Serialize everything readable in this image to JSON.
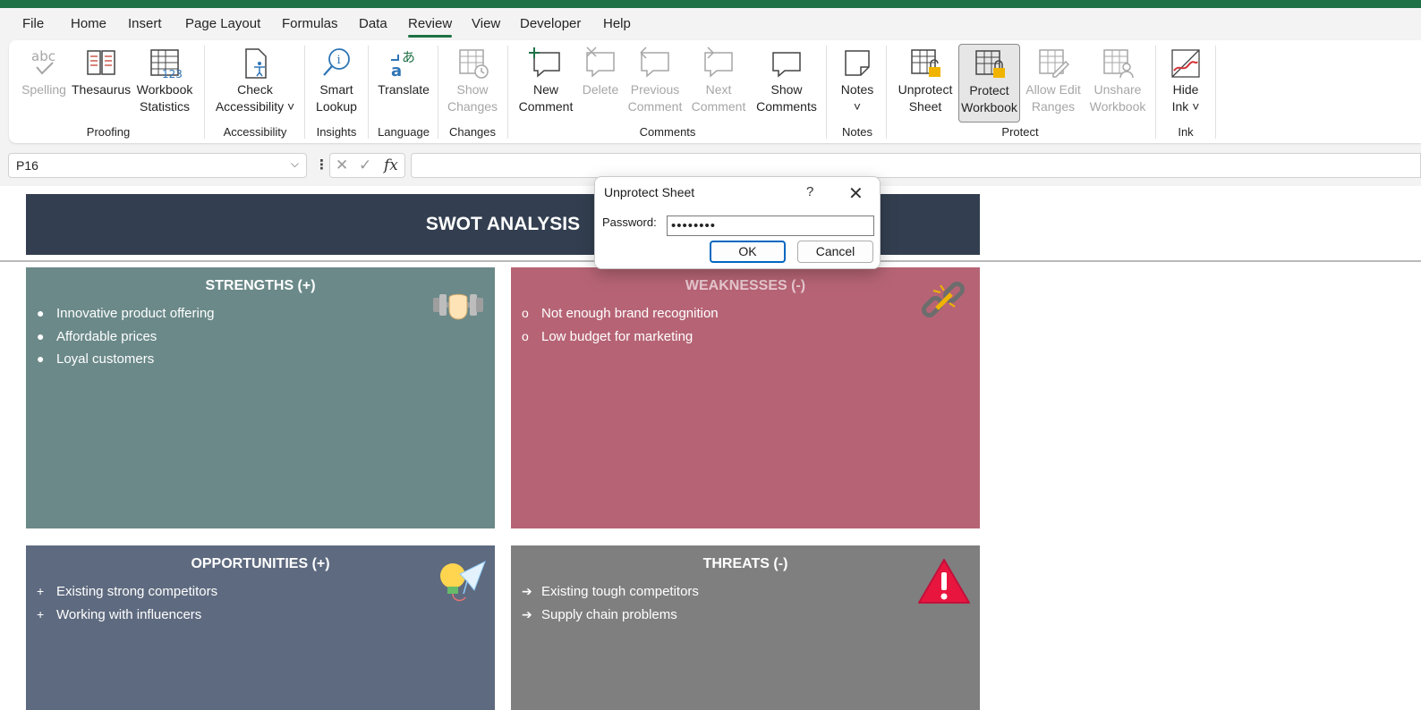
{
  "menu": {
    "items": [
      "File",
      "Home",
      "Insert",
      "Page Layout",
      "Formulas",
      "Data",
      "Review",
      "View",
      "Developer",
      "Help"
    ],
    "active": "Review"
  },
  "ribbon": {
    "spelling": "Spelling",
    "thesaurus": "Thesaurus",
    "workbook_statistics_1": "Workbook",
    "workbook_statistics_2": "Statistics",
    "proofing": "Proofing",
    "check_accessibility_1": "Check",
    "check_accessibility_2": "Accessibility ˅",
    "accessibility": "Accessibility",
    "smart_lookup_1": "Smart",
    "smart_lookup_2": "Lookup",
    "insights": "Insights",
    "translate": "Translate",
    "language": "Language",
    "show_changes_1": "Show",
    "show_changes_2": "Changes",
    "changes": "Changes",
    "new_comment_1": "New",
    "new_comment_2": "Comment",
    "delete": "Delete",
    "previous_comment_1": "Previous",
    "previous_comment_2": "Comment",
    "next_comment_1": "Next",
    "next_comment_2": "Comment",
    "show_comments_1": "Show",
    "show_comments_2": "Comments",
    "comments": "Comments",
    "notes_btn": "Notes",
    "notes_chev": "˅",
    "notes": "Notes",
    "unprotect_sheet_1": "Unprotect",
    "unprotect_sheet_2": "Sheet",
    "protect_workbook_1": "Protect",
    "protect_workbook_2": "Workbook",
    "allow_edit_1": "Allow Edit",
    "allow_edit_2": "Ranges",
    "unshare_1": "Unshare",
    "unshare_2": "Workbook",
    "protect": "Protect",
    "hide_ink_1": "Hide",
    "hide_ink_2": "Ink ˅",
    "ink": "Ink"
  },
  "formula_bar": {
    "name_box": "P16",
    "fx": "fx",
    "value": ""
  },
  "sheet": {
    "title": "SWOT ANALYSIS",
    "strengths": {
      "title": "STRENGTHS (+)",
      "items": [
        "Innovative product offering",
        "Affordable prices",
        "Loyal customers"
      ],
      "color": "#6b8989"
    },
    "weaknesses": {
      "title": "WEAKNESSES (-)",
      "items": [
        "Not enough brand recognition",
        "Low budget for marketing"
      ],
      "color": "#b66475"
    },
    "opportunities": {
      "title": "OPPORTUNITIES (+)",
      "items": [
        "Existing strong competitors",
        "Working with influencers"
      ],
      "color": "#5e6a7f"
    },
    "threats": {
      "title": "THREATS (-)",
      "items": [
        "Existing tough competitors",
        "Supply chain problems"
      ],
      "color": "#7f7f7f"
    }
  },
  "dialog": {
    "title": "Unprotect Sheet",
    "help": "?",
    "close": "✕",
    "password_label": "Password:",
    "password_value": "••••••••",
    "ok": "OK",
    "cancel": "Cancel"
  },
  "colors": {
    "accent": "#1e7145",
    "title_band": "#333f50"
  }
}
